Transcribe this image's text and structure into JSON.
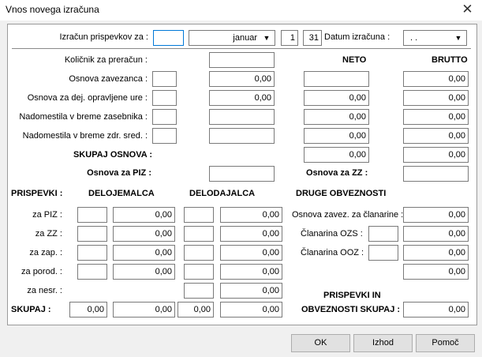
{
  "window": {
    "title": "Vnos novega izračuna",
    "close_glyph": "✕"
  },
  "top": {
    "label_izracun": "Izračun prispevkov za :",
    "month": "januar",
    "day_from": "1",
    "day_to": "31",
    "label_datum": "Datum izračuna :",
    "datum_value": " .  ."
  },
  "headers": {
    "neto": "NETO",
    "brutto": "BRUTTO"
  },
  "rows": {
    "kolicnik": "Količnik za preračun :",
    "osnova_zav": "Osnova zavezanca :",
    "osnova_dej": "Osnova za dej. opravljene ure :",
    "nad_zas": "Nadomestila v breme zasebnika :",
    "nad_zdr": "Nadomestila v breme zdr. sred. :",
    "skupaj_osnova": "SKUPAJ OSNOVA :",
    "osnova_piz": "Osnova za PIZ :",
    "osnova_zz": "Osnova za ZZ :"
  },
  "values": {
    "osnova_zav_mid": "0,00",
    "osnova_zav_neto": "",
    "osnova_zav_brutto": "0,00",
    "osnova_dej_mid": "0,00",
    "osnova_dej_neto": "0,00",
    "osnova_dej_brutto": "0,00",
    "nad_zas_neto": "0,00",
    "nad_zas_brutto": "0,00",
    "nad_zdr_neto": "0,00",
    "nad_zdr_brutto": "0,00",
    "skupaj_neto": "0,00",
    "skupaj_brutto": "0,00"
  },
  "prispevki": {
    "label": "PRISPEVKI :",
    "delojemalca": "DELOJEMALCA",
    "delodajalca": "DELODAJALCA",
    "druge": "DRUGE OBVEZNOSTI",
    "za_piz": "za PIZ :",
    "za_zz": "za ZZ :",
    "za_zap": "za zap. :",
    "za_porod": "za porod. :",
    "za_nesr": "za nesr. :",
    "skupaj": "SKUPAJ :",
    "osnova_clan": "Osnova zavez. za članarine :",
    "clan_ozs": "Članarina OZS :",
    "clan_ooz": "Članarina OOZ :",
    "skupaj_title_1": "PRISPEVKI IN",
    "skupaj_title_2": "OBVEZNOSTI SKUPAJ :",
    "zero": "0,00"
  },
  "buttons": {
    "ok": "OK",
    "izhod": "Izhod",
    "pomoc": "Pomoč"
  }
}
